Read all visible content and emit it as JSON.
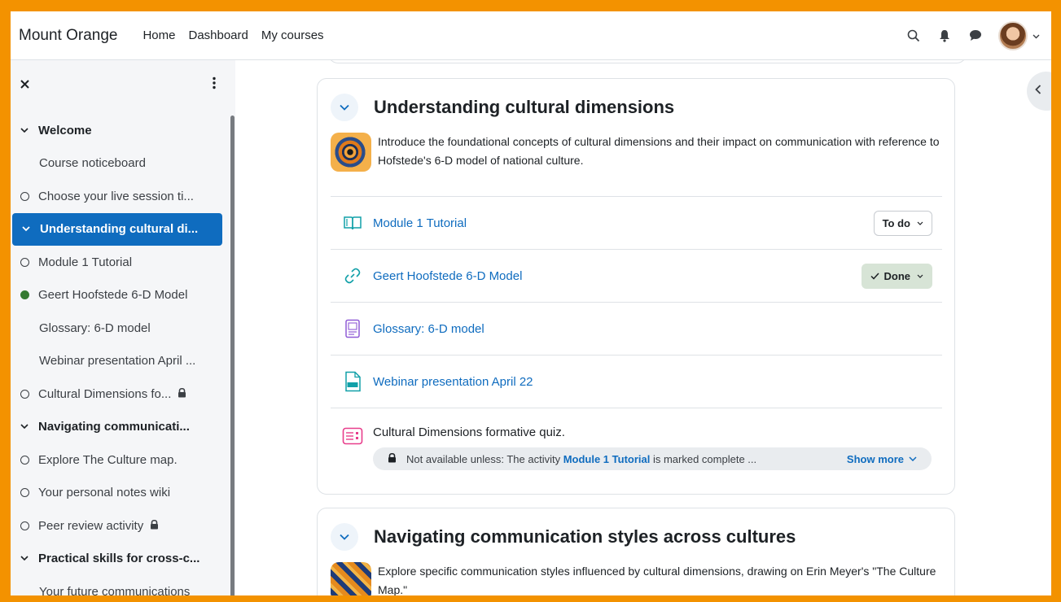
{
  "navbar": {
    "brand": "Mount Orange",
    "links": [
      "Home",
      "Dashboard",
      "My courses"
    ]
  },
  "sidebar": {
    "items": [
      {
        "label": "Welcome",
        "kind": "section"
      },
      {
        "label": "Course noticeboard",
        "kind": "plain"
      },
      {
        "label": "Choose your live session ti...",
        "kind": "todo"
      },
      {
        "label": "Understanding cultural di...",
        "kind": "section-active"
      },
      {
        "label": "Module 1 Tutorial",
        "kind": "todo"
      },
      {
        "label": "Geert Hoofstede 6-D Model",
        "kind": "done"
      },
      {
        "label": "Glossary: 6-D model",
        "kind": "plain"
      },
      {
        "label": "Webinar presentation April ...",
        "kind": "plain"
      },
      {
        "label": "Cultural Dimensions fo...",
        "kind": "todo-locked"
      },
      {
        "label": "Navigating communicati...",
        "kind": "section"
      },
      {
        "label": "Explore The Culture map.",
        "kind": "todo"
      },
      {
        "label": "Your personal notes wiki",
        "kind": "todo"
      },
      {
        "label": "Peer review activity",
        "kind": "todo-locked"
      },
      {
        "label": "Practical skills for cross-c...",
        "kind": "section"
      },
      {
        "label": "Your future communications",
        "kind": "plain"
      }
    ]
  },
  "sections": [
    {
      "title": "Understanding cultural dimensions",
      "summary": "Introduce the foundational concepts of cultural dimensions and their impact on communication with reference to Hofstede's 6-D model of national culture.",
      "activities": [
        {
          "label": "Module 1 Tutorial",
          "icon": "book-icon",
          "completion": "To do"
        },
        {
          "label": "Geert Hoofstede 6-D Model",
          "icon": "link-icon",
          "completion": "Done"
        },
        {
          "label": "Glossary: 6-D model",
          "icon": "glossary-icon"
        },
        {
          "label": "Webinar presentation April 22",
          "icon": "ppt-file-icon"
        },
        {
          "label": "Cultural Dimensions formative quiz.",
          "icon": "quiz-icon"
        }
      ],
      "restriction": {
        "prefix": "Not available unless: The activity ",
        "activity": "Module 1 Tutorial",
        "suffix": " is marked complete ...",
        "show_more": "Show more"
      }
    },
    {
      "title": "Navigating communication styles across cultures",
      "summary": "Explore specific communication styles influenced by cultural dimensions, drawing on Erin Meyer's \"The Culture Map.\""
    }
  ],
  "colors": {
    "accent": "#0f6cbf",
    "frame": "#f39200",
    "done_bg": "#d7e4d6",
    "done_dot": "#357a32"
  }
}
